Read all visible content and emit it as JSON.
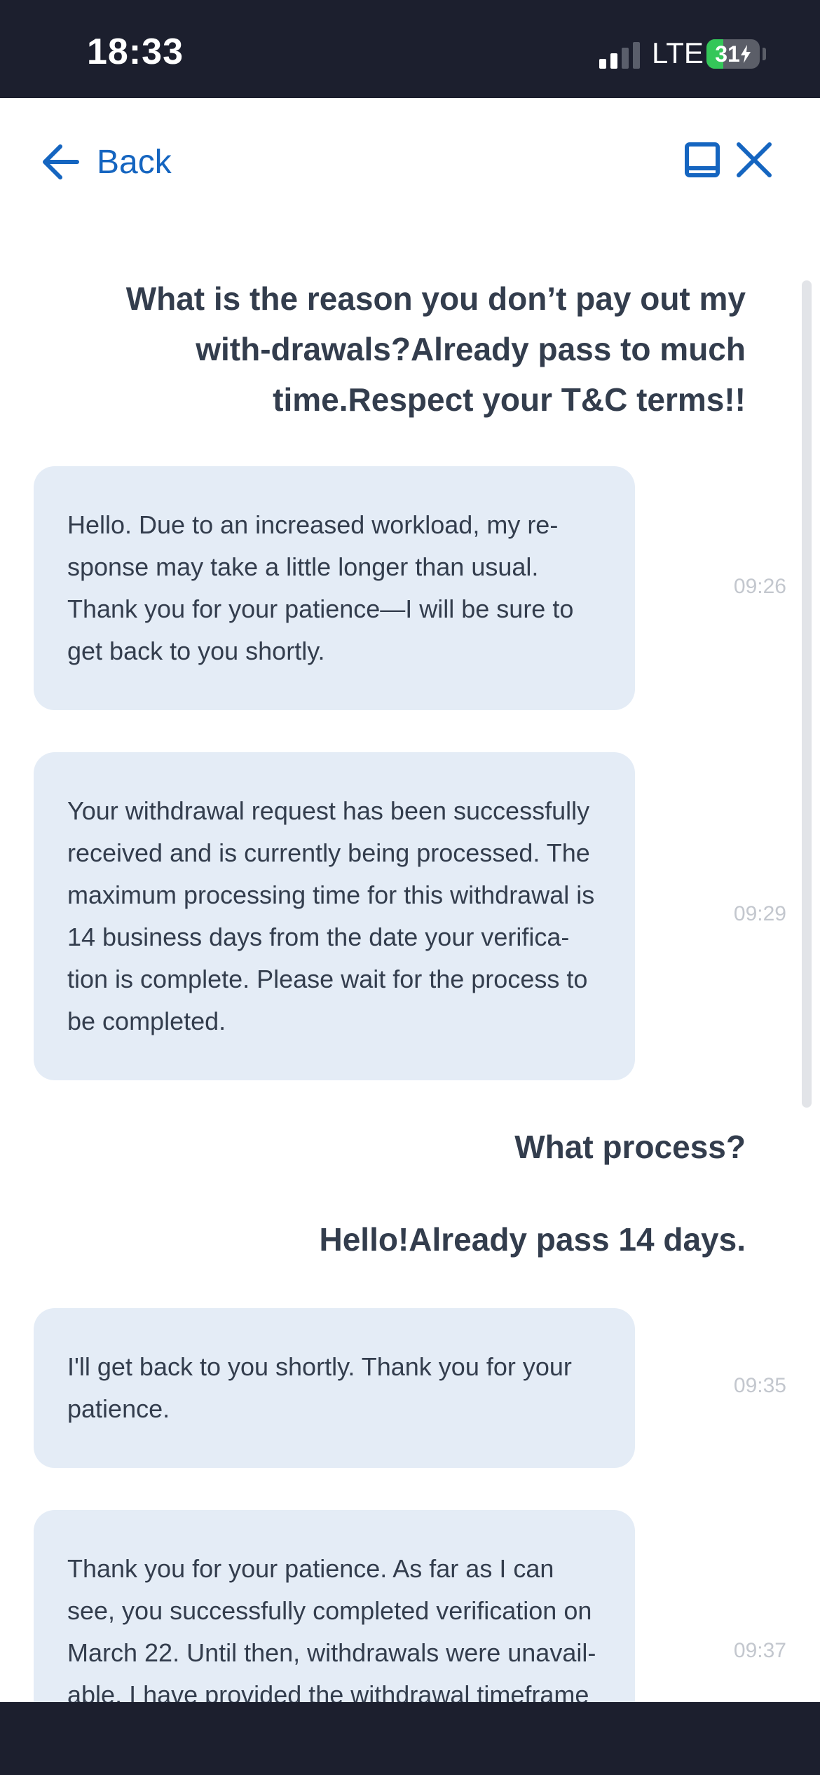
{
  "status_bar": {
    "time": "18:33",
    "network": "LTE",
    "battery": "31",
    "battery_level_percent": 31,
    "battery_charging": true,
    "signal_bars_active": 2,
    "signal_bars_total": 4
  },
  "header": {
    "back_label": "Back",
    "back_icon": "arrow-left-icon",
    "minimize_icon": "minimize-icon",
    "close_icon": "close-icon",
    "accent_color": "#1565c0"
  },
  "messages": [
    {
      "role": "user",
      "text": "What is the reason you don’t pay out my with-drawals?Already pass to much time.Respect your T&C terms!!"
    },
    {
      "role": "agent",
      "text": "Hello. Due to an increased workload, my re-sponse may take a little longer than usual. Thank you for your patience—I will be sure to get back to you shortly.",
      "time": "09:26"
    },
    {
      "role": "agent",
      "text": "Your withdrawal request has been successfully received and is currently being processed. The maximum processing time for this withdrawal is 14 business days from the date your verifica-tion is complete. Please wait for the process to be completed.",
      "time": "09:29"
    },
    {
      "role": "user",
      "text": "What process?"
    },
    {
      "role": "user",
      "text": "Hello!Already pass 14 days."
    },
    {
      "role": "agent",
      "text": "I'll get back to you shortly. Thank you for your patience.",
      "time": "09:35"
    },
    {
      "role": "agent",
      "text": "Thank you for your patience. As far as I can see, you successfully completed verification on March 22. Until then, withdrawals were unavail-able. I have provided the withdrawal timeframe",
      "time": "09:37"
    }
  ],
  "colors": {
    "status_bar_bg": "#1c1f2e",
    "agent_bubble_bg": "#e4ecf6",
    "text_dark": "#333d4d",
    "timestamp": "#c3c7ce"
  }
}
